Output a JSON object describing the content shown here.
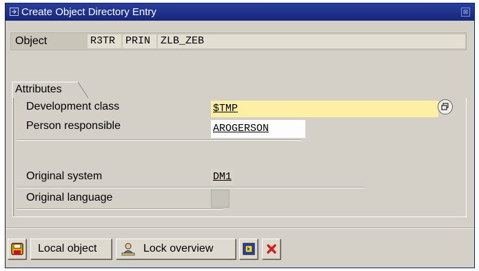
{
  "window": {
    "title": "Create Object Directory Entry",
    "close_glyph": "⊠"
  },
  "object": {
    "label": "Object",
    "pgmid": "R3TR",
    "type": "PRIN",
    "name": "ZLB_ZEB"
  },
  "attributes": {
    "group_title": "Attributes",
    "development_class": {
      "label": "Development class",
      "value": "$TMP"
    },
    "person_responsible": {
      "label": "Person responsible",
      "value": "AROGERSON"
    },
    "original_system": {
      "label": "Original system",
      "value": "DM1"
    },
    "original_language": {
      "label": "Original language",
      "value": ""
    }
  },
  "toolbar": {
    "save_icon": "save-icon",
    "local_object_label": "Local object",
    "lock_overview_label": "Lock overview",
    "lock_overview_icon": "person-lock-icon",
    "display_icon": "display-object-icon",
    "cancel_icon": "cancel-icon"
  },
  "colors": {
    "titlebar": "#1c2f8c",
    "dialog_bg": "#d4d0c8",
    "required_field": "#fdf0a4",
    "cancel_red": "#d21c1c"
  }
}
